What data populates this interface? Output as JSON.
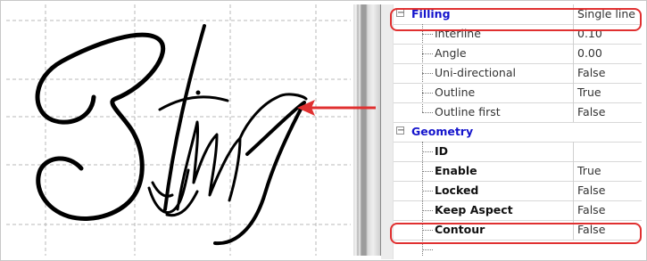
{
  "colors": {
    "category_text": "#1414cc",
    "highlight": "#e03030",
    "arrow": "#e03030"
  },
  "canvas": {
    "script_icon": "string-script-glyph-icon"
  },
  "properties": {
    "filling": {
      "label": "Filling",
      "value": "Single line",
      "rows": [
        {
          "label": "Interline",
          "value": "0.10"
        },
        {
          "label": "Angle",
          "value": "0.00"
        },
        {
          "label": "Uni-directional",
          "value": "False"
        },
        {
          "label": "Outline",
          "value": "True"
        },
        {
          "label": "Outline first",
          "value": "False"
        }
      ]
    },
    "geometry": {
      "label": "Geometry",
      "rows": [
        {
          "label": "ID",
          "value": ""
        },
        {
          "label": "Enable",
          "value": "True"
        },
        {
          "label": "Locked",
          "value": "False"
        },
        {
          "label": "Keep Aspect",
          "value": "False"
        },
        {
          "label": "Contour",
          "value": "False"
        }
      ]
    }
  }
}
